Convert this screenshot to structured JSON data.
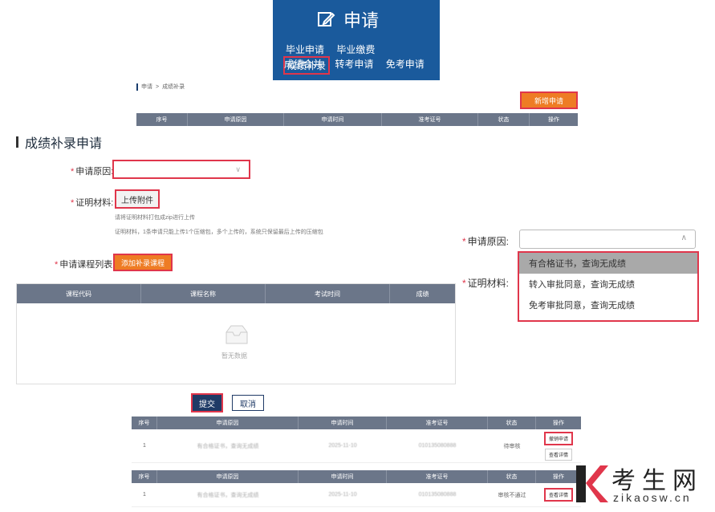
{
  "banner": {
    "title": "申请",
    "row1": [
      "毕业申请",
      "毕业缴费",
      "成绩补录"
    ],
    "row2": [
      "成绩合并",
      "转考申请",
      "免考申请"
    ],
    "bg_color": "#1a5a9c"
  },
  "breadcrumb": [
    "申请",
    ">",
    "成绩补录"
  ],
  "new_button": "新增申请",
  "top_table_headers": [
    "序号",
    "申请原因",
    "申请时间",
    "准考证号",
    "状态",
    "操作"
  ],
  "form": {
    "title": "成绩补录申请",
    "reason_label": "申请原因:",
    "material_label": "证明材料:",
    "upload_button": "上传附件",
    "hint1": "请将证明材料打包成zip进行上传",
    "hint2": "证明材料，1条申请只能上传1个压缩包，多个上传的，系统只保留最后上传的压缩包",
    "course_list_label": "申请课程列表:",
    "add_course_button": "添加补录课程",
    "course_table_headers": [
      "课程代码",
      "课程名称",
      "考试时间",
      "成绩"
    ],
    "empty_text": "暂无数据",
    "submit": "提交",
    "cancel": "取消"
  },
  "dropdown": {
    "reason_label": "申请原因:",
    "material_label": "证明材料:",
    "options": [
      "有合格证书，查询无成绩",
      "转入审批同意，查询无成绩",
      "免考审批同意，查询无成绩"
    ]
  },
  "result1": {
    "headers": [
      "序号",
      "申请原因",
      "申请时间",
      "准考证号",
      "状态",
      "操作"
    ],
    "row": {
      "index": "1",
      "reason": "有合格证书，查询无成绩",
      "time": "2025-11-10",
      "ticket": "010135080888",
      "status": "待审核",
      "action1": "撤销申请",
      "action2": "查看详情"
    }
  },
  "result2": {
    "headers": [
      "序号",
      "申请原因",
      "申请时间",
      "准考证号",
      "状态",
      "操作"
    ],
    "row": {
      "index": "1",
      "reason": "有合格证书，查询无成绩",
      "time": "2025-11-10",
      "ticket": "010135080888",
      "status": "审核不通过",
      "action": "查看详情"
    }
  },
  "watermark": {
    "cn": "考生网",
    "en": "zikaosw.cn"
  },
  "colors": {
    "accent_orange": "#ee7c24",
    "highlight_red": "#e0364b",
    "header_gray": "#6b7689",
    "navy": "#1f3a66"
  }
}
